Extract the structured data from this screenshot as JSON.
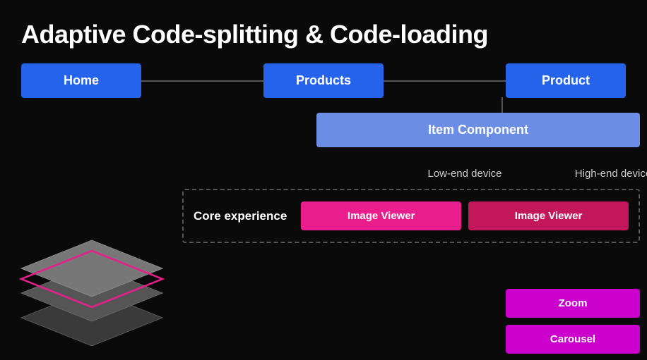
{
  "title": "Adaptive Code-splitting & Code-loading",
  "routes": {
    "home": "Home",
    "products": "Products",
    "product": "Product"
  },
  "item_component": "Item Component",
  "device_labels": {
    "low_end": "Low-end device",
    "high_end": "High-end device"
  },
  "core_experience": "Core experience",
  "image_viewer": "Image Viewer",
  "image_viewer_high": "Image Viewer",
  "zoom": "Zoom",
  "carousel": "Carousel",
  "colors": {
    "route_blue": "#2563eb",
    "item_blue": "#6b8de3",
    "pink_hot": "#e91e8c",
    "pink_dark": "#c2185b",
    "purple": "#cc00cc"
  }
}
